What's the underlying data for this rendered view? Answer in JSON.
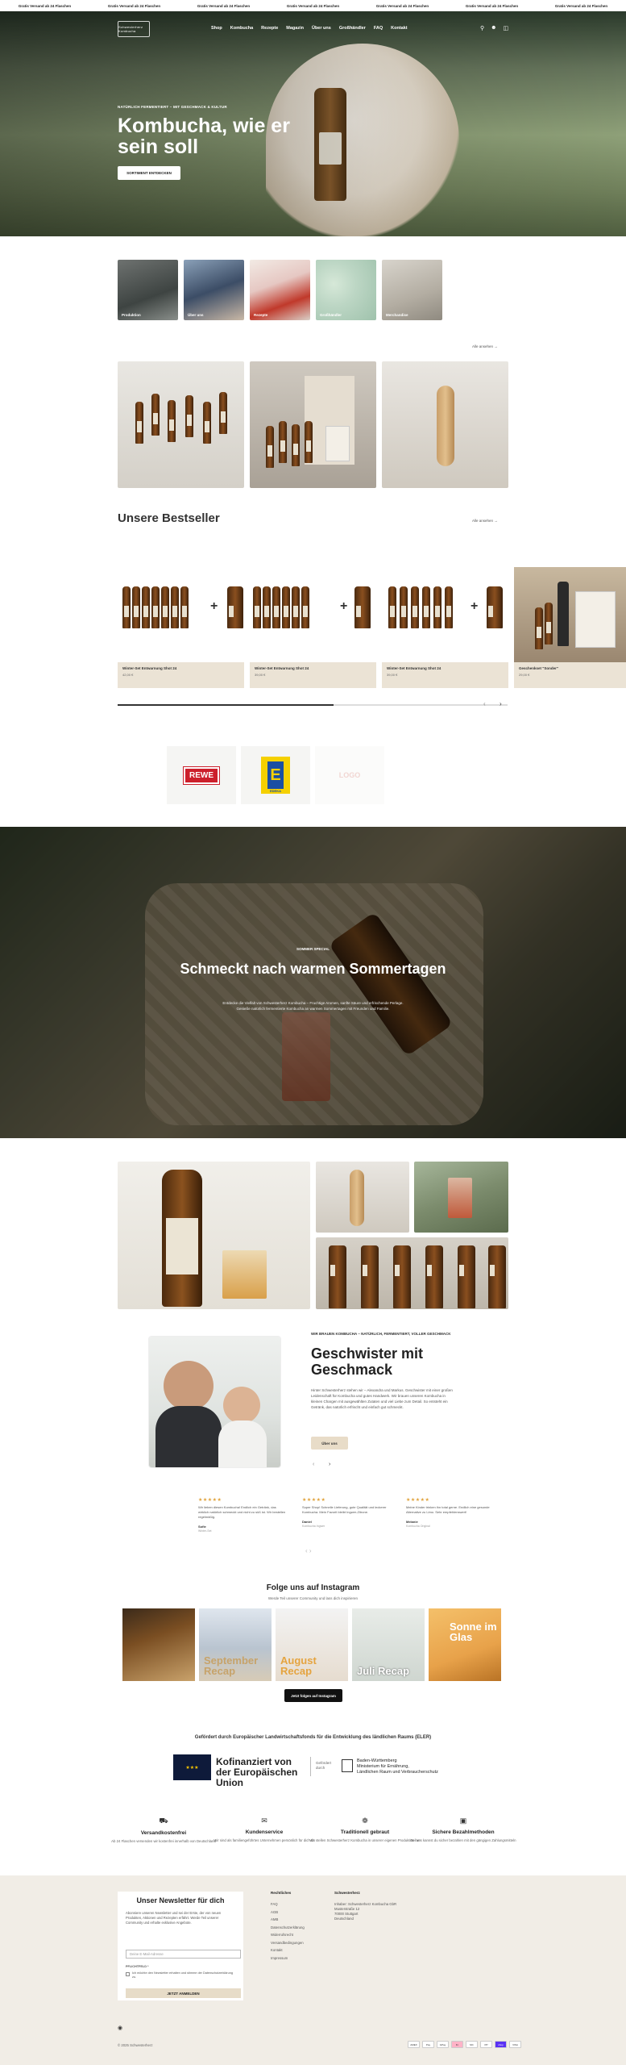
{
  "announcement": {
    "items": [
      "Gratis Versand ab 24 Flaschen",
      "Gratis Versand ab 24 Flaschen",
      "Gratis Versand ab 24 Flaschen",
      "Gratis Versand ab 24 Flaschen",
      "Gratis Versand ab 24 Flaschen",
      "Gratis Versand ab 24 Flaschen",
      "Gratis Versand ab 24 Flaschen"
    ]
  },
  "header": {
    "logo_text": "Schwesterherz Kombucha",
    "nav": [
      "Shop",
      "Kombucha",
      "Rezepte",
      "Magazin",
      "Über uns",
      "Großhändler",
      "FAQ",
      "Kontakt"
    ],
    "icons": [
      "search-icon",
      "account-icon",
      "cart-icon"
    ]
  },
  "hero": {
    "kicker": "NATÜRLICH FERMENTIERT – MIT GESCHMACK & KULTUR",
    "title": "Kombucha, wie er sein soll",
    "cta": "SORTIMENT ENTDECKEN"
  },
  "categories": [
    {
      "label": "Produktion"
    },
    {
      "label": "Über uns"
    },
    {
      "label": "Rezepte"
    },
    {
      "label": "Großhändler"
    },
    {
      "label": "Merchandise"
    }
  ],
  "features": {
    "all_link": "Alle ansehen"
  },
  "bestsellers": {
    "title": "Unsere Bestseller",
    "all_link": "Alle ansehen",
    "products": [
      {
        "name": "Winter-Set Entwarnung Shot 24",
        "price": "42,00 €"
      },
      {
        "name": "Winter-Set Entwarnung Shot 24",
        "price": "39,00 €"
      },
      {
        "name": "Winter-Set Entwarnung Shot 24",
        "price": "39,00 €"
      },
      {
        "name": "Geschenkset \"Sonder\"",
        "price": "29,00 €"
      }
    ]
  },
  "retailers": [
    "REWE",
    "EDEKA",
    "LOGO"
  ],
  "banner": {
    "kicker": "SOMMER SPECIAL",
    "title": "Schmeckt nach warmen Sommertagen",
    "text": "Entdecke die Vielfalt von Schwesterherz Kombucha – Fruchtige Aromen, sanfte Säure und erfrischende Perlage. Genieße natürlich fermentierte Kombucha an warmen Sommertagen mit Freunden und Familie."
  },
  "siblings": {
    "kicker": "WIR BRAUEN KOMBUCHA – NATÜRLICH, FERMENTIERT, VOLLER GESCHMACK",
    "title": "Geschwister mit Geschmack",
    "text": "Hinter Schwesterherz stehen wir – Alexandra und Markus. Geschwister mit einer großen Leidenschaft für Kombucha und gutes Handwerk. Wir brauen unseren Kombucha in kleinen Chargen mit ausgewählten Zutaten und viel Liebe zum Detail. So entsteht ein Getränk, das natürlich erfrischt und einfach gut schmeckt.",
    "cta": "Über uns"
  },
  "reviews": [
    {
      "stars": "★★★★★",
      "text": "Wir lieben diesen Kombucha! Endlich ein Getränk, das wirklich natürlich schmeckt und nicht zu süß ist. Wir bestellen regelmäßig.",
      "who": "Sofie",
      "product": "Winter-Set"
    },
    {
      "stars": "★★★★★",
      "text": "Super Shop! Schnelle Lieferung, gute Qualität und leckerer Kombucha. Mein Favorit bleibt Ingwer-Zitrone.",
      "who": "Daniel",
      "product": "Kombucha Ingwer"
    },
    {
      "stars": "★★★★★",
      "text": "Meine Kinder trinken ihn total gerne. Endlich eine gesunde Alternative zu Limo. Sehr empfehlenswert!",
      "who": "Melanie",
      "product": "Kombucha Original"
    }
  ],
  "instagram": {
    "title": "Folge uns auf Instagram",
    "subtitle": "Werde Teil unserer Community und lass dich inspirieren",
    "tiles": [
      "",
      "September Recap",
      "August Recap",
      "Juli Recap",
      "Sonne im Glas"
    ],
    "cta": "Jetzt folgen auf Instagram"
  },
  "eu": {
    "title": "Gefördert durch Europäischer Landwirtschaftsfonds für die Entwicklung des ländlichen Raums (ELER)",
    "cofinanced": "Kofinanziert von der Europäischen Union",
    "by": "Gefördert durch",
    "ministry": "Baden-Württemberg\nMinisterium für Ernährung,\nLändlichen Raum und Verbraucherschutz"
  },
  "usps": [
    {
      "icon": "truck-icon",
      "title": "Versandkostenfrei",
      "desc": "Ab 24 Flaschen versenden wir kostenfrei innerhalb von Deutschland"
    },
    {
      "icon": "chat-icon",
      "title": "Kundenservice",
      "desc": "Wir sind als familiengeführtes Unternehmen persönlich für dich da"
    },
    {
      "icon": "leaf-icon",
      "title": "Traditionell gebraut",
      "desc": "Wir stellen Schwesterherz Kombucha in unserer eigenen Produktion her"
    },
    {
      "icon": "lock-icon",
      "title": "Sichere Bezahlmethoden",
      "desc": "Bei uns kannst du sicher bezahlen mit den gängigen Zahlungsmitteln"
    }
  ],
  "footer": {
    "newsletter_title": "Unser Newsletter für dich",
    "newsletter_text": "Abonniere unseren Newsletter und sei der Erste, der von neuen Produkten, Aktionen und Rezepten erfährt. Werde Teil unserer Community und erhalte exklusive Angebote.",
    "email_placeholder": "Deine E-Mail-Adresse",
    "required": "PFLICHTFELD *",
    "consent": "Ich möchte den Newsletter erhalten und stimme der Datenschutzerklärung zu.",
    "subscribe": "JETZT ANMELDEN",
    "links_title": "Rechtliches",
    "links": [
      "FAQ",
      "AGB",
      "AMB",
      "Datenschutzerklärung",
      "Widerrufsrecht",
      "Versandbedingungen",
      "Kontakt",
      "Impressum"
    ],
    "address_title": "Schwesterherz",
    "address": "Inhaber: Schwesterherz Kombucha GbR\nMusterstraße 12\n70000 Stuttgart\nDeutschland",
    "copyright": "© 2025 Schwesterherz",
    "payments": [
      "AMEX",
      "Pay",
      "GPay",
      "Kl.",
      "MC",
      "PP",
      "shop",
      "VISA"
    ]
  }
}
